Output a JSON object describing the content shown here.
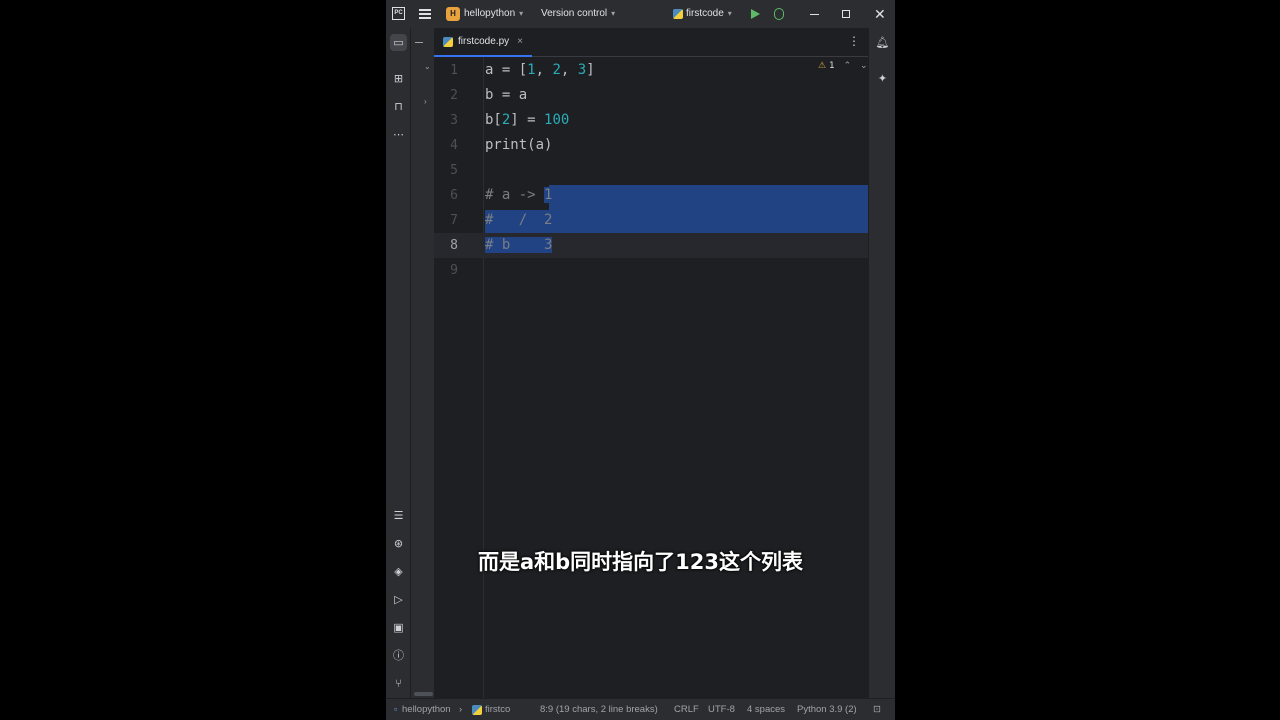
{
  "titlebar": {
    "project_badge": "H",
    "project_name": "hellopython",
    "version_control": "Version control",
    "run_config": "firstcode",
    "chevron": "⌄"
  },
  "tab": {
    "filename": "firstcode.py",
    "close": "×",
    "menu": "⋮"
  },
  "inspection": {
    "warning_count": "1"
  },
  "editor": {
    "line_numbers": [
      "1",
      "2",
      "3",
      "4",
      "5",
      "6",
      "7",
      "8",
      "9"
    ],
    "lines": [
      {
        "parts": [
          {
            "t": "a = [",
            "c": ""
          },
          {
            "t": "1",
            "c": "num"
          },
          {
            "t": ", ",
            "c": ""
          },
          {
            "t": "2",
            "c": "num"
          },
          {
            "t": ", ",
            "c": ""
          },
          {
            "t": "3",
            "c": "num"
          },
          {
            "t": "]",
            "c": ""
          }
        ]
      },
      {
        "parts": [
          {
            "t": "b = a",
            "c": ""
          }
        ]
      },
      {
        "parts": [
          {
            "t": "b[",
            "c": ""
          },
          {
            "t": "2",
            "c": "num"
          },
          {
            "t": "] = ",
            "c": ""
          },
          {
            "t": "100",
            "c": "num"
          }
        ]
      },
      {
        "parts": [
          {
            "t": "print(a)",
            "c": ""
          }
        ]
      },
      {
        "parts": []
      },
      {
        "parts": [
          {
            "t": "# a -> ",
            "c": "cmt"
          },
          {
            "t": "1",
            "c": "cmt sel"
          }
        ]
      },
      {
        "parts": [
          {
            "t": "#   /  2",
            "c": "cmt sel"
          }
        ]
      },
      {
        "parts": [
          {
            "t": "# b    3",
            "c": "cmt sel"
          }
        ]
      },
      {
        "parts": []
      }
    ],
    "current_line": 8
  },
  "statusbar": {
    "breadcrumb_project": "hellopython",
    "breadcrumb_file": "firstco",
    "position": "8:9 (19 chars, 2 line breaks)",
    "line_ending": "CRLF",
    "encoding": "UTF-8",
    "indent": "4 spaces",
    "interpreter": "Python 3.9 (2)"
  },
  "subtitle": "而是a和b同时指向了123这个列表",
  "colors": {
    "selection": "#214283",
    "number": "#2aacb8",
    "comment": "#7a7e85",
    "accent": "#3574f0",
    "run_green": "#5fb865"
  },
  "icons": {
    "left_toolbar": [
      "project-folder-icon",
      "structure-icon",
      "bookmarks-icon",
      "more-icon",
      "todo-list-icon",
      "python-packages-icon",
      "layers-icon",
      "services-icon",
      "terminal-icon",
      "problems-icon",
      "git-icon"
    ],
    "right_toolbar": [
      "notifications-icon",
      "ai-assistant-icon"
    ]
  }
}
